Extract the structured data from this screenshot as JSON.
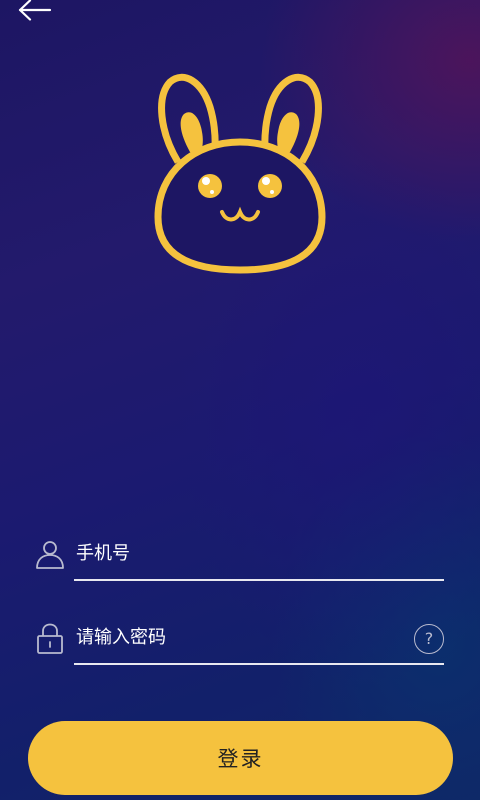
{
  "phone_field": {
    "placeholder": "手机号",
    "value": ""
  },
  "password_field": {
    "placeholder": "请输入密码",
    "value": ""
  },
  "help_label": "?",
  "login_button": {
    "label": "登录"
  },
  "colors": {
    "accent": "#f5c23e",
    "text": "#ffffff"
  },
  "icons": {
    "back": "arrow-left-icon",
    "logo": "bunny-logo-icon",
    "user": "user-icon",
    "lock": "lock-icon",
    "help": "help-circle-icon"
  }
}
